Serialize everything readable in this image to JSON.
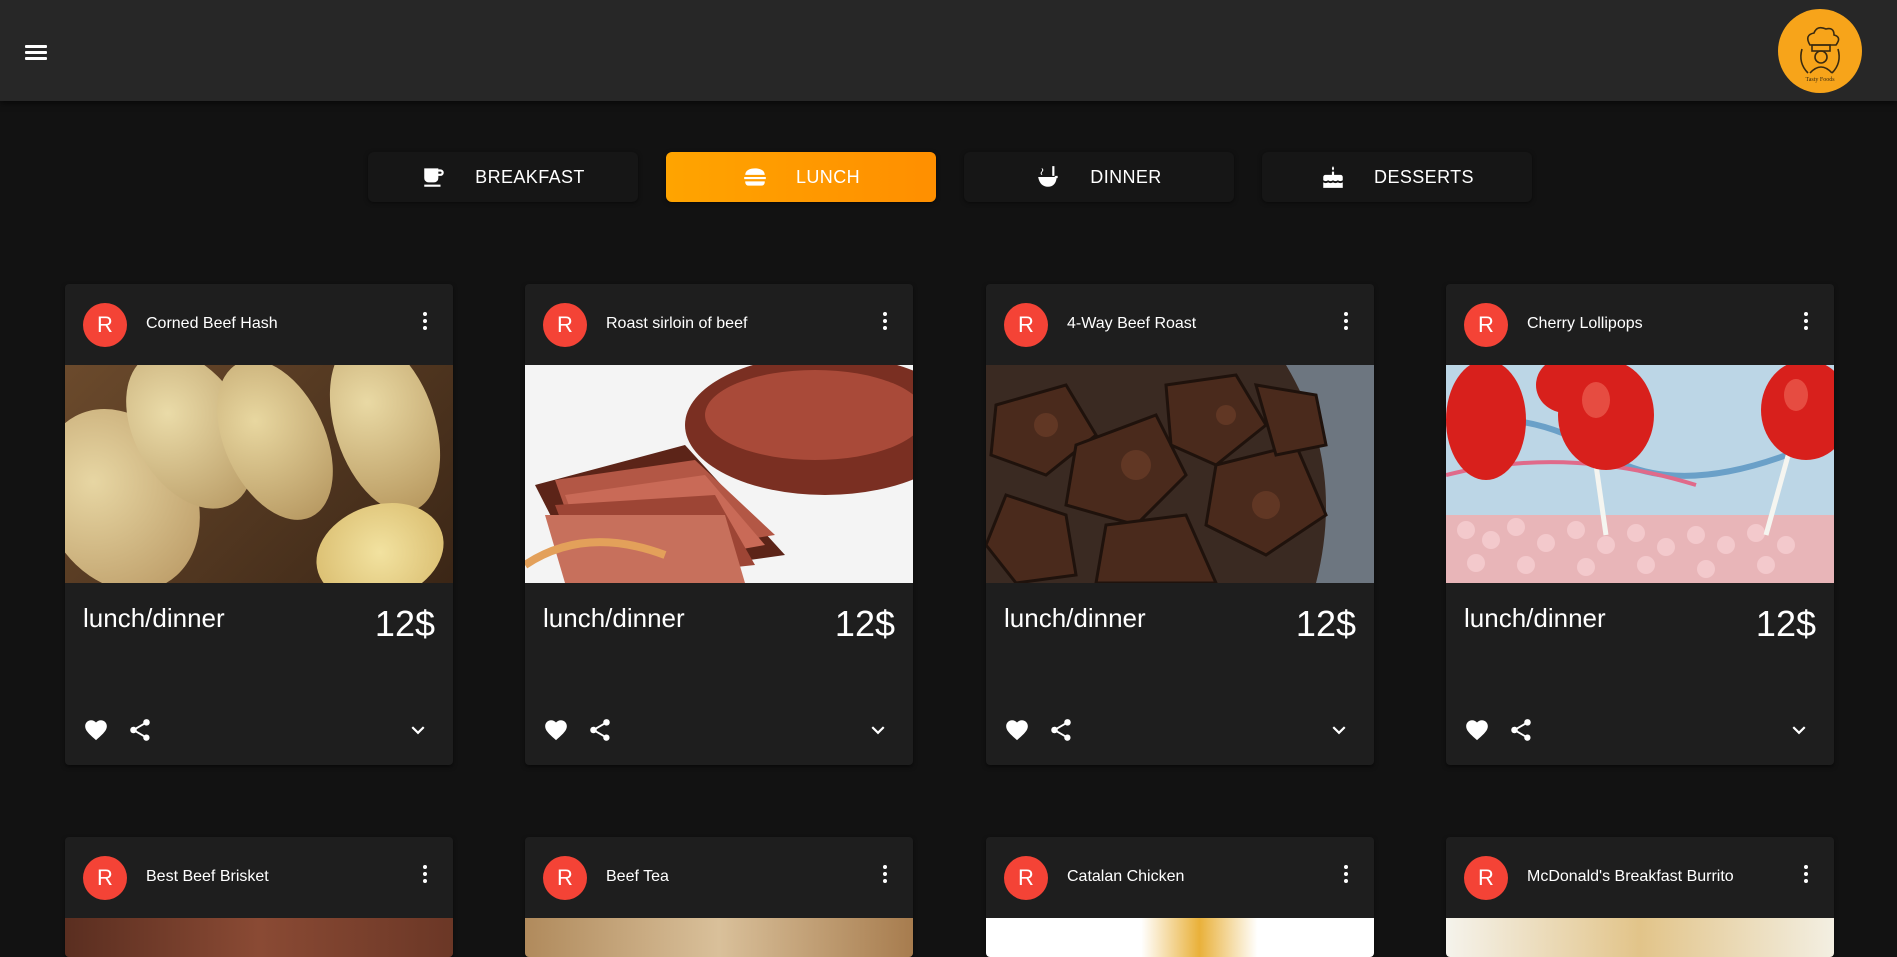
{
  "header": {
    "menu_icon": "hamburger-menu-icon",
    "logo_icon": "chef-logo-icon",
    "logo_text": "Tasty Foods"
  },
  "tabs": [
    {
      "label": "BREAKFAST",
      "icon": "coffee-icon",
      "active": false
    },
    {
      "label": "LUNCH",
      "icon": "burger-icon",
      "active": true
    },
    {
      "label": "DINNER",
      "icon": "soup-icon",
      "active": false
    },
    {
      "label": "DESSERTS",
      "icon": "cake-icon",
      "active": false
    }
  ],
  "colors": {
    "accent": "#ffa400",
    "avatar": "#f44336",
    "card": "#1e1e1e",
    "background": "#121212",
    "appbar": "#272727"
  },
  "cards": [
    {
      "avatar": "R",
      "title": "Corned Beef Hash",
      "category": "lunch/dinner",
      "price": "12$"
    },
    {
      "avatar": "R",
      "title": "Roast sirloin of beef",
      "category": "lunch/dinner",
      "price": "12$"
    },
    {
      "avatar": "R",
      "title": "4-Way Beef Roast",
      "category": "lunch/dinner",
      "price": "12$"
    },
    {
      "avatar": "R",
      "title": "Cherry Lollipops",
      "category": "lunch/dinner",
      "price": "12$"
    },
    {
      "avatar": "R",
      "title": "Best Beef Brisket"
    },
    {
      "avatar": "R",
      "title": "Beef Tea"
    },
    {
      "avatar": "R",
      "title": "Catalan Chicken"
    },
    {
      "avatar": "R",
      "title": "McDonald's Breakfast Burrito"
    }
  ]
}
